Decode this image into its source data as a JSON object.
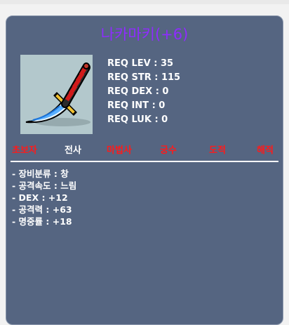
{
  "item": {
    "name": "나카마키(+6)",
    "icon": "dagger-icon",
    "name_color": "#8f2bff"
  },
  "requirements": [
    "REQ LEV : 35",
    "REQ STR : 115",
    "REQ DEX : 0",
    "REQ INT : 0",
    "REQ LUK : 0"
  ],
  "jobs": [
    {
      "label": "초보자",
      "status": "unavailable",
      "color": "#ff1a1a"
    },
    {
      "label": "전사",
      "status": "available",
      "color": "#ffffff"
    },
    {
      "label": "마법사",
      "status": "unavailable",
      "color": "#ff1a1a"
    },
    {
      "label": "궁수",
      "status": "unavailable",
      "color": "#ff1a1a"
    },
    {
      "label": "도적",
      "status": "unavailable",
      "color": "#ff1a1a"
    },
    {
      "label": "해적",
      "status": "unavailable",
      "color": "#ff1a1a"
    }
  ],
  "stats": [
    "- 장비분류 : 창",
    "- 공격속도 : 느림",
    "- DEX : +12",
    "- 공격력 : +63",
    "- 명중률 : +18"
  ],
  "panel_color": "#556581"
}
